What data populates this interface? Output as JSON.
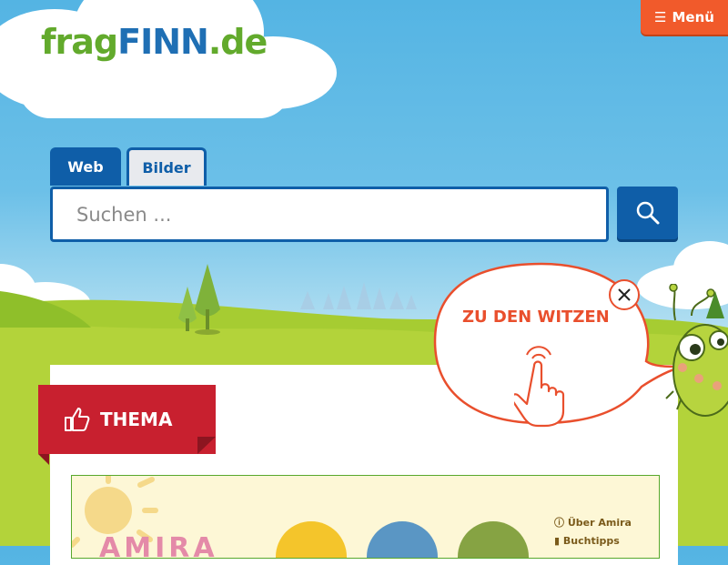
{
  "header": {
    "logo_frag": "frag",
    "logo_finn": "FINN",
    "logo_de": ".de",
    "menu_label": "Menü",
    "menu_icon": "hamburger-icon"
  },
  "search": {
    "tabs": [
      {
        "label": "Web",
        "active": true
      },
      {
        "label": "Bilder",
        "active": false
      }
    ],
    "placeholder": "Suchen ...",
    "value": "",
    "button_icon": "search-icon"
  },
  "jokes_bubble": {
    "label": "ZU DEN WITZEN",
    "close_icon": "close-icon",
    "pointer_icon": "pointing-hand-icon",
    "mascot": "finn-mascot"
  },
  "topic": {
    "label": "THEMA",
    "icon": "thumbs-up-icon"
  },
  "teaser": {
    "title_partial": "AMIRA",
    "links": [
      "Über Amira",
      "Buchtipps"
    ]
  },
  "colors": {
    "brand_blue": "#0f5ea8",
    "brand_green": "#62aa2c",
    "menu_orange": "#f15a2b",
    "ribbon_red": "#c8202f",
    "bubble_red": "#e94f2d"
  }
}
